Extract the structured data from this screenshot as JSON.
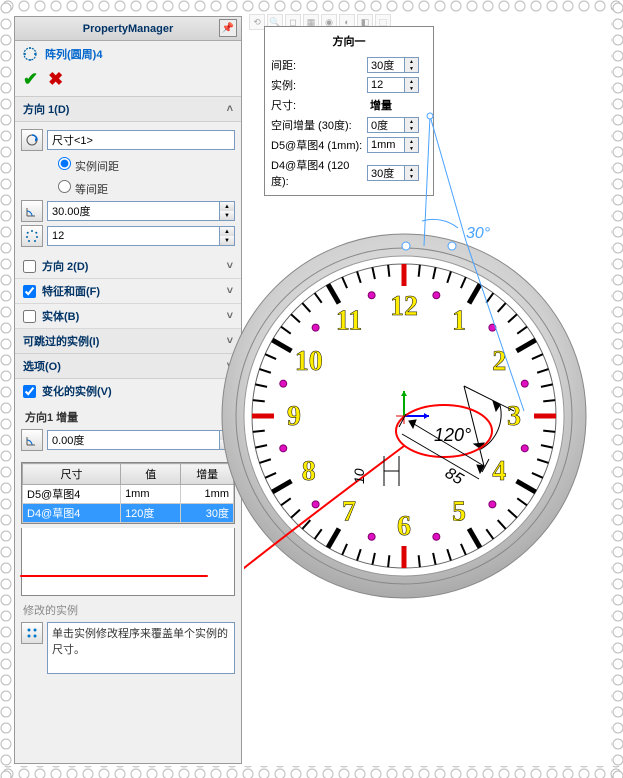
{
  "header": {
    "title": "PropertyManager"
  },
  "feature": {
    "name": "阵列(圆周)4"
  },
  "sections": {
    "dir1": {
      "title": "方向 1(D)",
      "axis_input": "尺寸<1>",
      "radio_spacing": "实例间距",
      "radio_equal": "等间距",
      "angle": "30.00度",
      "count": "12"
    },
    "dir2": {
      "title": "方向 2(D)",
      "checked": false
    },
    "feat_face": {
      "title": "特征和面(F)",
      "checked": true
    },
    "bodies": {
      "title": "实体(B)",
      "checked": false
    },
    "skip": {
      "title": "可跳过的实例(I)"
    },
    "options": {
      "title": "选项(O)"
    },
    "vary": {
      "title": "变化的实例(V)",
      "checked": true,
      "sublabel": "方向1 增量",
      "increment": "0.00度"
    }
  },
  "table": {
    "headers": [
      "尺寸",
      "值",
      "增量"
    ],
    "rows": [
      {
        "dim": "D5@草图4",
        "val": "1mm",
        "inc": "1mm",
        "selected": false
      },
      {
        "dim": "D4@草图4",
        "val": "120度",
        "inc": "30度",
        "selected": true
      }
    ]
  },
  "modify": {
    "label": "修改的实例",
    "text": "单击实例修改程序来覆盖单个实例的尺寸。"
  },
  "float": {
    "title": "方向一",
    "rows": [
      {
        "label": "间距:",
        "value": "30度",
        "spin": true
      },
      {
        "label": "实例:",
        "value": "12",
        "spin": true
      },
      {
        "label": "尺寸:",
        "value": "增量",
        "spin": false,
        "bold": true
      },
      {
        "label": "空间增量 (30度):",
        "value": "0度",
        "spin": true
      },
      {
        "label": "D5@草图4 (1mm):",
        "value": "1mm",
        "spin": true
      },
      {
        "label": "D4@草图4 (120度):",
        "value": "30度",
        "spin": true
      }
    ]
  },
  "dims": {
    "angle_30": "30°",
    "angle_120": "120°",
    "dist_85": "85",
    "dist_10": "10"
  },
  "clock_numbers": [
    "12",
    "1",
    "2",
    "3",
    "4",
    "5",
    "6",
    "7",
    "8",
    "9",
    "10",
    "11"
  ]
}
